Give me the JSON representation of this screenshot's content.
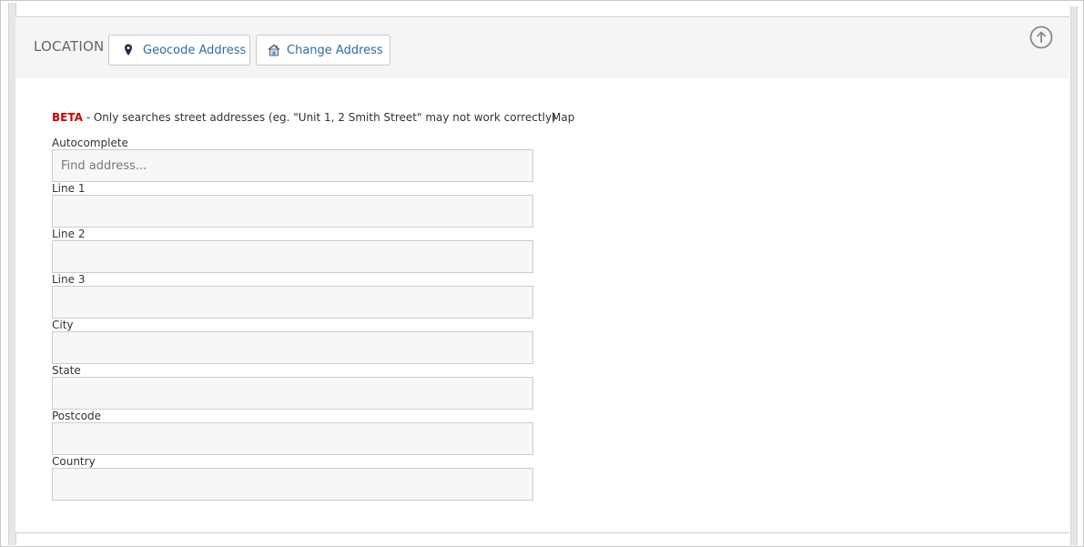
{
  "section": {
    "title": "LOCATION",
    "buttons": {
      "geocode_label": "Geocode Address",
      "change_label": "Change Address"
    }
  },
  "notice": {
    "beta_tag": "BETA",
    "message": " - Only searches street addresses (eg. \"Unit 1, 2 Smith Street\" may not work correctly)"
  },
  "map": {
    "label": "Map"
  },
  "fields": {
    "autocomplete": {
      "label": "Autocomplete",
      "placeholder": "Find address...",
      "value": ""
    },
    "line1": {
      "label": "Line 1",
      "value": ""
    },
    "line2": {
      "label": "Line 2",
      "value": ""
    },
    "line3": {
      "label": "Line 3",
      "value": ""
    },
    "city": {
      "label": "City",
      "value": ""
    },
    "state": {
      "label": "State",
      "value": ""
    },
    "postcode": {
      "label": "Postcode",
      "value": ""
    },
    "country": {
      "label": "Country",
      "value": ""
    }
  },
  "icons": {
    "geocode": "map-marker-icon",
    "change": "house-icon",
    "collapse": "arrow-up-circle-icon"
  },
  "colors": {
    "link": "#2e6da4",
    "beta": "#cc0000",
    "header_bg": "#f5f5f5",
    "input_bg": "#f7f7f7"
  }
}
